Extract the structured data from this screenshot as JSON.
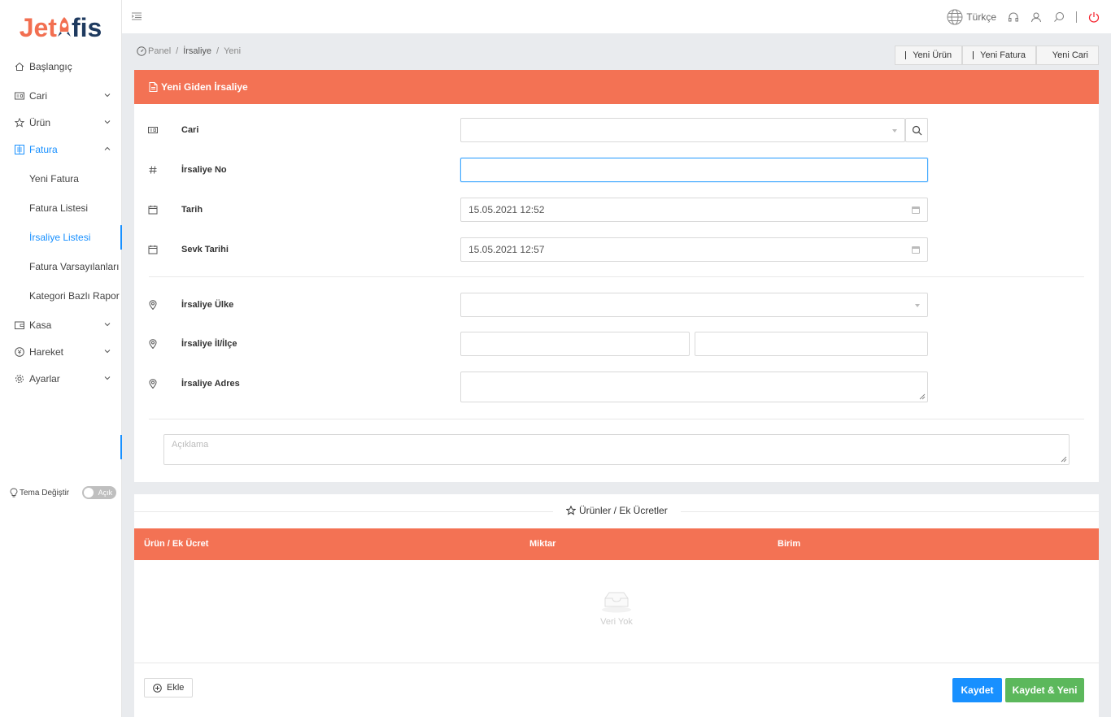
{
  "app": {
    "logo_left": "Jet",
    "logo_right": "fis"
  },
  "sidebar": {
    "items": [
      {
        "label": "Başlangıç",
        "icon": "home-icon"
      },
      {
        "label": "Cari",
        "icon": "id-card-icon"
      },
      {
        "label": "Ürün",
        "icon": "star-icon"
      },
      {
        "label": "Fatura",
        "icon": "invoice-icon"
      },
      {
        "label": "Kasa",
        "icon": "wallet-icon"
      },
      {
        "label": "Hareket",
        "icon": "currency-icon"
      },
      {
        "label": "Ayarlar",
        "icon": "gear-icon"
      }
    ],
    "fatura_sub": [
      "Yeni Fatura",
      "Fatura Listesi",
      "İrsaliye Listesi",
      "Fatura Varsayılanları",
      "Kategori Bazlı Rapor"
    ],
    "theme_label": "Tema Değiştir",
    "theme_toggle": "Açık"
  },
  "topbar": {
    "language": "Türkçe"
  },
  "breadcrumb": {
    "root": "Panel",
    "sep1": "/",
    "mid": "İrsaliye",
    "sep2": "/",
    "current": "Yeni"
  },
  "quick_buttons": [
    "Yeni Ürün",
    "Yeni Fatura",
    "Yeni Cari"
  ],
  "form": {
    "title": "Yeni Giden İrsaliye",
    "cari_label": "Cari",
    "cari_value": "",
    "irsaliye_no_label": "İrsaliye No",
    "irsaliye_no_value": "",
    "tarih_label": "Tarih",
    "tarih_value": "15.05.2021 12:52",
    "sevk_label": "Sevk Tarihi",
    "sevk_value": "15.05.2021 12:57",
    "ulke_label": "İrsaliye Ülke",
    "il_ilce_label": "İrsaliye İl/İlçe",
    "adres_label": "İrsaliye Adres",
    "aciklama_placeholder": "Açıklama"
  },
  "products": {
    "section_title": "Ürünler / Ek Ücretler",
    "columns": [
      "Ürün / Ek Ücret",
      "Miktar",
      "Birim"
    ],
    "empty_text": "Veri Yok",
    "add_label": "Ekle",
    "save_label": "Kaydet",
    "save_new_label": "Kaydet & Yeni"
  },
  "colors": {
    "accent": "#f37254",
    "primary": "#1890ff",
    "success": "#5cb85c"
  }
}
